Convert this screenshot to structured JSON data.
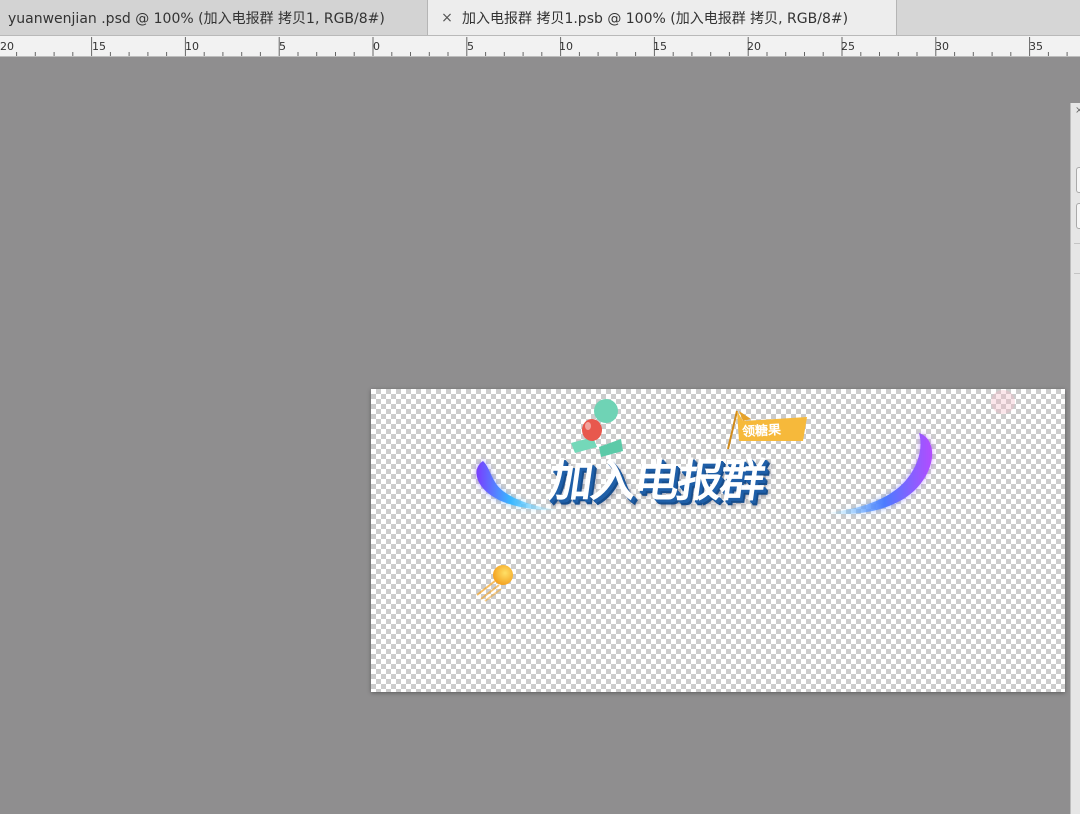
{
  "tabs": [
    {
      "label": "yuanwenjian .psd @ 100% (加入电报群 拷贝1, RGB/8#)",
      "active": false
    },
    {
      "label": "加入电报群 拷贝1.psb @ 100% (加入电报群 拷贝, RGB/8#)",
      "active": true,
      "close_icon": "×"
    }
  ],
  "ruler": {
    "labels": [
      "20",
      "15",
      "10",
      "5",
      "0",
      "5",
      "10",
      "15",
      "20",
      "25",
      "30",
      "35"
    ]
  },
  "panel": {
    "close_icon": "×"
  },
  "canvas": {
    "banner_title": "加入电报群",
    "flag_text": "领糖果",
    "colors": {
      "title_fill": "#ffffff",
      "title_shadow": "#1f5fa8",
      "flag": "#f6b93b",
      "balloon_red": "#e8584d",
      "balloon_teal": "#6fd3b5",
      "swoosh_start": "#37d0ff",
      "swoosh_end": "#7a3cff",
      "comet": "#f6c830"
    }
  }
}
